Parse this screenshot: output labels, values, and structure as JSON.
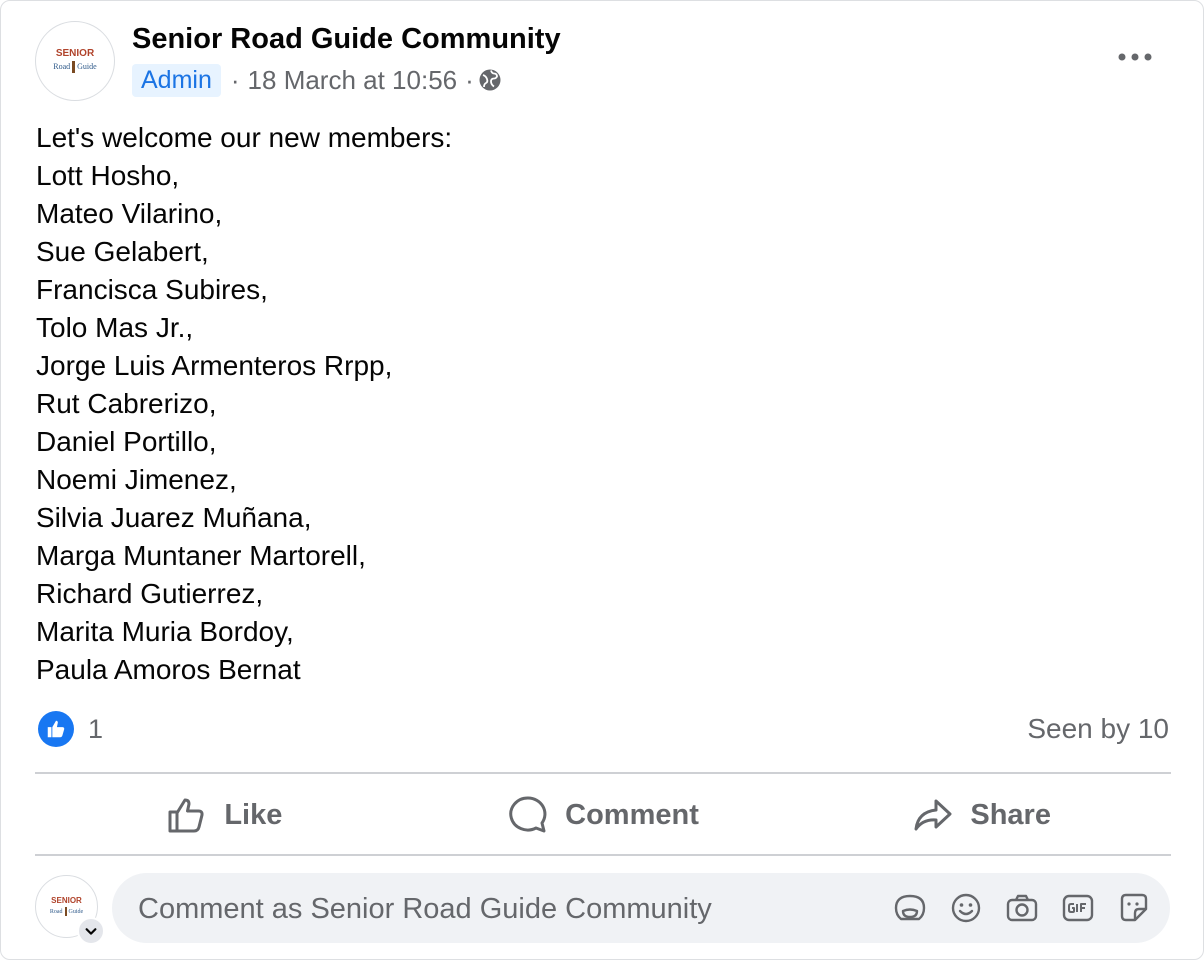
{
  "post": {
    "author": "Senior Road Guide Community",
    "avatar_logo_top": "SENIOR",
    "avatar_logo_left": "Road",
    "avatar_logo_right": "Guide",
    "badge": "Admin",
    "separator": "·",
    "timestamp": "18 March at 10:56",
    "audience_icon": "globe-icon",
    "more_icon": "more-options-icon",
    "intro": "Let's welcome our new members:",
    "members": [
      "Lott Hosho,",
      "Mateo Vilarino,",
      "Sue Gelabert,",
      "Francisca Subires,",
      "Tolo Mas Jr.,",
      "Jorge Luis Armenteros Rrpp,",
      "Rut Cabrerizo,",
      "Daniel Portillo,",
      "Noemi Jimenez,",
      "Silvia Juarez Muñana,",
      "Marga Muntaner Martorell,",
      "Richard Gutierrez,",
      "Marita Muria Bordoy,",
      "Paula Amoros Bernat"
    ]
  },
  "reactions": {
    "like_count": "1",
    "seen": "Seen by 10"
  },
  "actions": {
    "like": "Like",
    "comment": "Comment",
    "share": "Share"
  },
  "composer": {
    "placeholder": "Comment as Senior Road Guide Community",
    "icons": [
      "avatar-sticker-icon",
      "emoji-icon",
      "camera-icon",
      "gif-icon",
      "sticker-icon"
    ]
  },
  "colors": {
    "accent": "#1877f2",
    "badge_bg": "#e7f3ff",
    "badge_text": "#1b74e4",
    "secondary_text": "#65676b",
    "composer_bg": "#f0f2f5"
  }
}
